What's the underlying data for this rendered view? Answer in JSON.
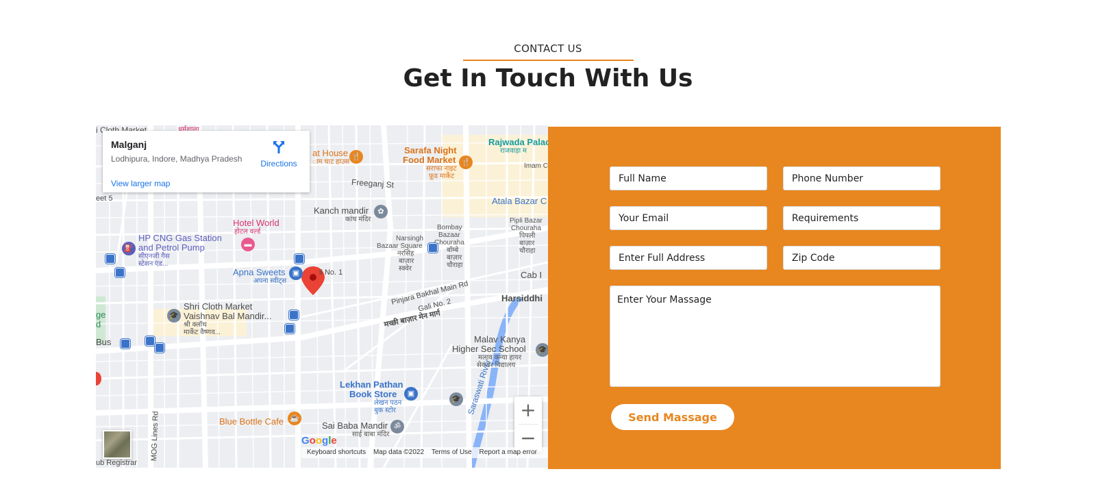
{
  "section": {
    "eyebrow": "CONTACT US",
    "title": "Get In Touch With Us",
    "accent_color": "#e8861f"
  },
  "map": {
    "card": {
      "place": "Malganj",
      "address": "Lodhipura, Indore, Madhya Pradesh",
      "directions_label": "Directions",
      "larger_map_label": "View larger map"
    },
    "labels": {
      "cloth_market_top": "i Cloth Market",
      "dharamshala": "धर्मशाला",
      "heat_house": "at House",
      "heat_house_hi": "ाम चाट हाउस",
      "sarafa": "Sarafa Night",
      "sarafa2": "Food Market",
      "sarafa_hi": "सराफा नाइट",
      "sarafa_hi2": "फ़ूड मार्केट",
      "rajwada": "Rajwada Palac",
      "rajwada_hi": "राजवाड़ा म",
      "imam": "Imam Ch",
      "freeganj": "Freeganj St",
      "street5": "eet 5",
      "kanch": "Kanch mandir",
      "kanch_hi": "कांच मंदिर",
      "atala": "Atala Bazar C",
      "hotel_world": "Hotel World",
      "hotel_world_hi": "होटल वर्ल्ड",
      "hp_cng": "HP CNG Gas Station",
      "hp_cng2": "and Petrol Pump",
      "hp_cng_hi": "सीएनजी गैस",
      "hp_cng_hi2": "स्टेशन एंड...",
      "bombay": "Bombay",
      "bombay2": "Bazaar",
      "bombay3": "Chouraha",
      "bombay_hi": "बॉम्बे",
      "bombay_hi2": "बाज़ार",
      "bombay_hi3": "चौराहा",
      "narsingh": "Narsingh",
      "narsingh2": "Bazaar Square",
      "narsingh_hi": "नरसिंह",
      "narsingh_hi2": "बाज़ार",
      "narsingh_hi3": "स्क्वेर",
      "pipli": "Pipli Bazar",
      "pipli2": "Chouraha",
      "pipli_hi": "पिपली",
      "pipli_hi2": "बाज़ार",
      "pipli_hi3": "चौराहा",
      "apna_sweets": "Apna Sweets",
      "apna_sweets_hi": "अपना स्वीट्स",
      "gali1": "li No. 1",
      "cab": "Cab I",
      "pinjara": "Pinjara Bakhal Main Rd",
      "gali2": "Gali No. 2",
      "harsiddhi": "Harsiddhi",
      "shri_cloth": "Shri Cloth Market",
      "shri_cloth2": "Vaishnav Bal Mandir...",
      "shri_cloth_hi": "श्री क्लॉथ",
      "shri_cloth_hi2": "मार्केट वैष्णव...",
      "machhi": "मच्छी बाज़ार मेन मार्ग",
      "ge": "ge",
      "d": "d",
      "bus": "Bus",
      "malav": "Malav Kanya",
      "malav2": "Higher Sec School",
      "malav_hi": "मलाव कन्या हायर",
      "malav_hi2": "सेकंडर विद्यालय",
      "lekhan": "Lekhan Pathan",
      "lekhan2": "Book Store",
      "lekhan_hi": "लेखन पठन",
      "lekhan_hi2": "बुक स्टोर",
      "saraswati": "Saraswati River",
      "blue_bottle": "Blue Bottle Cafe",
      "sai_baba": "Sai Baba Mandir",
      "sai_baba_hi": "साई बाबा मंदिर",
      "mog_lines": "MOG Lines Rd",
      "sub_registrar": "ub Registrar"
    },
    "zoom_in": "+",
    "zoom_out": "−",
    "google": {
      "g1": "G",
      "o1": "o",
      "o2": "o",
      "g2": "g",
      "l": "l",
      "e": "e"
    },
    "attribution": {
      "shortcuts": "Keyboard shortcuts",
      "mapdata": "Map data ©2022",
      "terms": "Terms of Use",
      "report": "Report a map error"
    }
  },
  "form": {
    "background_color": "#e8861f",
    "full_name": "Full Name",
    "phone": "Phone Number",
    "email": "Your Email",
    "requirements": "Requirements",
    "address": "Enter Full Address",
    "zip": "Zip Code",
    "message": "Enter Your Massage",
    "send_label": "Send Massage"
  }
}
